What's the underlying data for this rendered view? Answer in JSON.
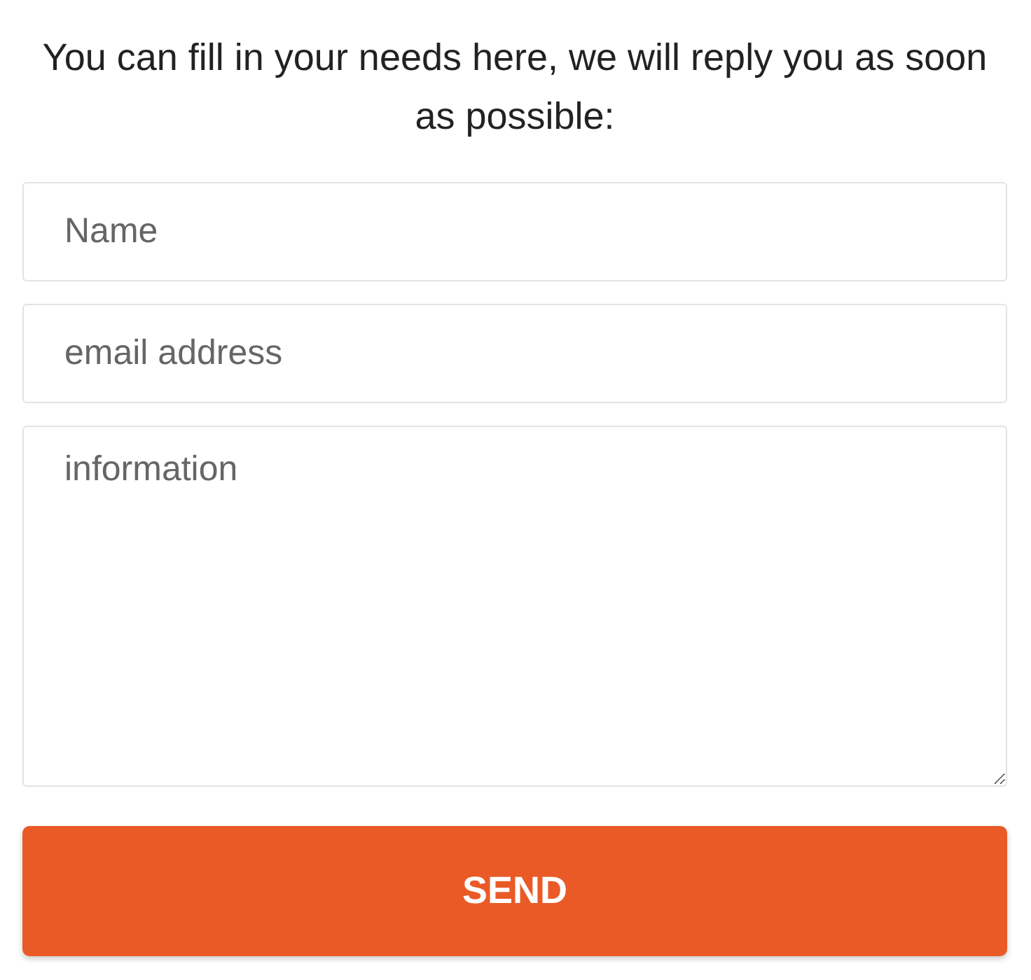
{
  "heading": "You can fill in your needs here, we will reply you as soon as possible:",
  "fields": [
    {
      "kind": "text",
      "placeholder": "Name"
    },
    {
      "kind": "text",
      "placeholder": "email address"
    },
    {
      "kind": "textarea",
      "placeholder": "information"
    }
  ],
  "button": "SEND"
}
